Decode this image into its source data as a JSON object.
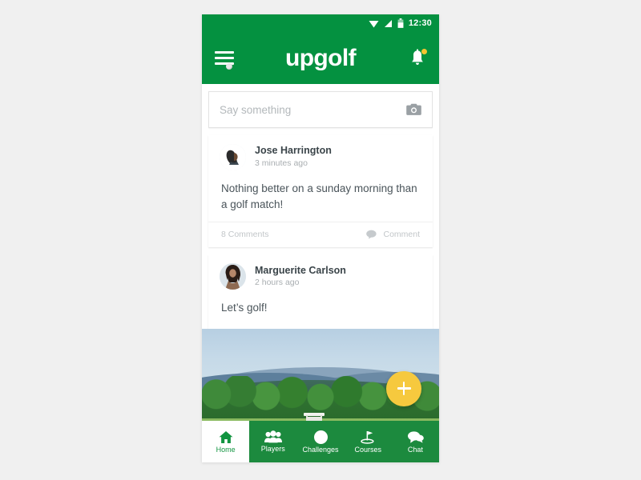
{
  "statusbar": {
    "time": "12:30",
    "icons": [
      "wifi-icon",
      "signal-icon",
      "battery-icon"
    ]
  },
  "appbar": {
    "menu_icon": "hamburger-menu-icon",
    "logo_text": "upgolf",
    "notification_icon": "bell-icon",
    "has_notification_dot": true,
    "background_color": "#049140"
  },
  "compose": {
    "placeholder": "Say something",
    "value": "",
    "camera_icon": "camera-icon"
  },
  "posts": [
    {
      "author": "Jose Harrington",
      "timestamp": "3 minutes ago",
      "text": "Nothing better on a sunday morning than a golf match!",
      "comment_count_label": "8 Comments",
      "comment_action_label": "Comment",
      "has_photo": false
    },
    {
      "author": "Marguerite Carlson",
      "timestamp": "2 hours ago",
      "text": "Let’s golf!",
      "has_photo": true,
      "photo_alt": "Golf course landscape with mountains, trees and a golf cart"
    }
  ],
  "fab": {
    "icon": "plus-icon",
    "color": "#f6c93e"
  },
  "bottomnav": {
    "background_color": "#1c8a3e",
    "active_color": "#119440",
    "items": [
      {
        "label": "Home",
        "icon": "home-icon",
        "active": true
      },
      {
        "label": "Players",
        "icon": "people-icon",
        "active": false
      },
      {
        "label": "Challenges",
        "icon": "golfball-icon",
        "active": false
      },
      {
        "label": "Courses",
        "icon": "golf-flag-icon",
        "active": false
      },
      {
        "label": "Chat",
        "icon": "chat-bubble-icon",
        "active": false
      }
    ]
  }
}
